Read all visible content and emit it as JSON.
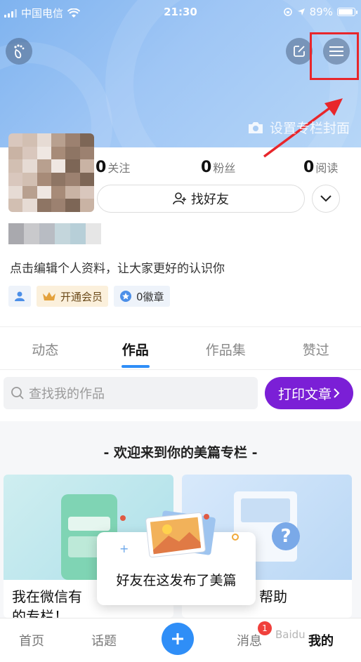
{
  "status_bar": {
    "carrier": "中国电信",
    "time": "21:30",
    "battery": "89%",
    "battery_level": 0.89
  },
  "header": {
    "cover_label": "设置专栏封面"
  },
  "profile": {
    "stats": [
      {
        "value": "0",
        "label": "关注"
      },
      {
        "value": "0",
        "label": "粉丝"
      },
      {
        "value": "0",
        "label": "阅读"
      }
    ],
    "find_friends_label": "找好友",
    "bio": "点击编辑个人资料，让大家更好的认识你",
    "vip_label": "开通会员",
    "medal_label": "0徽章"
  },
  "tabs": [
    "动态",
    "作品",
    "作品集",
    "赞过"
  ],
  "search": {
    "placeholder": "查找我的作品"
  },
  "print_button": "打印文章",
  "welcome": "- 欢迎来到你的美篇专栏 -",
  "cards": [
    {
      "title_line1": "我在微信有",
      "title_line2": "的专栏！"
    },
    {
      "title_line1": "帮助"
    }
  ],
  "popup": {
    "text": "好友在这发布了美篇"
  },
  "bottom_nav": {
    "home": "首页",
    "topics": "话题",
    "messages": "消息",
    "message_badge": "1",
    "mine": "我的",
    "watermark": "Baidu"
  },
  "colors": {
    "accent": "#2f8ef7",
    "print_button": "#7b1fd6",
    "highlight": "#e8262b"
  }
}
